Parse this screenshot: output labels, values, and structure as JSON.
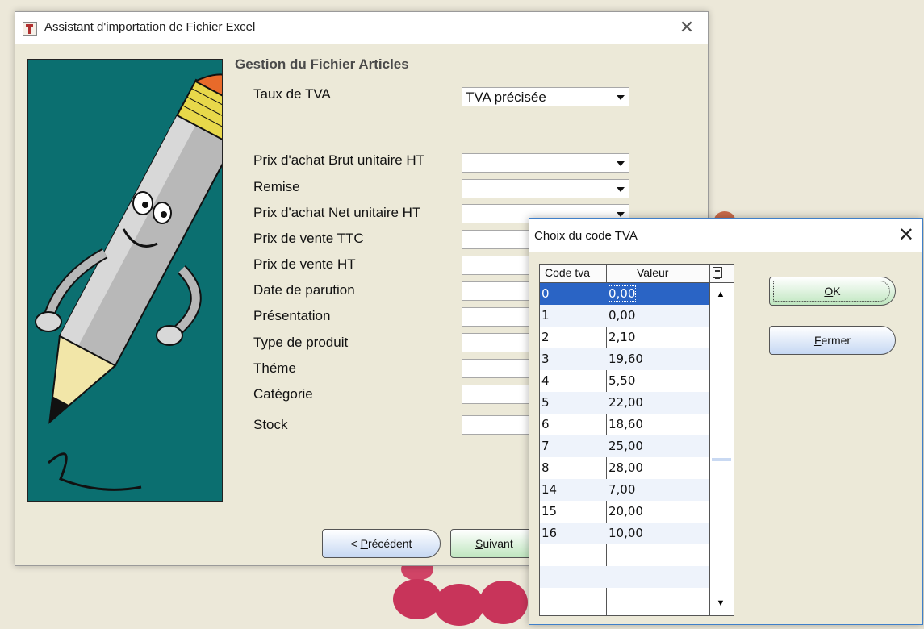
{
  "wizard": {
    "title": "Assistant d'importation de Fichier Excel",
    "section_title": "Gestion du Fichier Articles",
    "fields": [
      {
        "label": "Taux de TVA",
        "value": "TVA précisée",
        "dropdown": true
      },
      {
        "label": "Prix d'achat Brut unitaire HT",
        "value": "",
        "dropdown": true
      },
      {
        "label": "Remise",
        "value": "",
        "dropdown": true
      },
      {
        "label": "Prix d'achat Net unitaire HT",
        "value": "",
        "dropdown": true
      },
      {
        "label": "Prix de vente TTC",
        "value": "",
        "dropdown": false
      },
      {
        "label": "Prix de vente HT",
        "value": "",
        "dropdown": false
      },
      {
        "label": "Date de parution",
        "value": "",
        "dropdown": false
      },
      {
        "label": "Présentation",
        "value": "",
        "dropdown": false
      },
      {
        "label": "Type de produit",
        "value": "",
        "dropdown": false
      },
      {
        "label": "Théme",
        "value": "",
        "dropdown": false
      },
      {
        "label": "Catégorie",
        "value": "",
        "dropdown": false
      },
      {
        "label": "Stock",
        "value": "",
        "dropdown": false
      }
    ],
    "buttons": {
      "previous_prefix": "< ",
      "previous_mnemonic": "P",
      "previous_rest": "récédent",
      "next_mnemonic": "S",
      "next_rest": "uivant"
    }
  },
  "dialog": {
    "title": "Choix du code TVA",
    "columns": [
      "Code tva",
      "Valeur"
    ],
    "rows": [
      {
        "code": "0",
        "valeur": "0,00"
      },
      {
        "code": "1",
        "valeur": "0,00"
      },
      {
        "code": "2",
        "valeur": "2,10"
      },
      {
        "code": "3",
        "valeur": "19,60"
      },
      {
        "code": "4",
        "valeur": "5,50"
      },
      {
        "code": "5",
        "valeur": "22,00"
      },
      {
        "code": "6",
        "valeur": "18,60"
      },
      {
        "code": "7",
        "valeur": "25,00"
      },
      {
        "code": "8",
        "valeur": "28,00"
      },
      {
        "code": "14",
        "valeur": "7,00"
      },
      {
        "code": "15",
        "valeur": "20,00"
      },
      {
        "code": "16",
        "valeur": "10,00"
      }
    ],
    "selected_row": 0,
    "buttons": {
      "ok_mnemonic": "O",
      "ok_rest": "K",
      "close_mnemonic": "F",
      "close_rest": "ermer"
    }
  },
  "colors": {
    "selection": "#2a64c5",
    "illustration_bg": "#0b6f70",
    "ok_button": "#bfe6bf",
    "close_button": "#c6d8f3"
  }
}
